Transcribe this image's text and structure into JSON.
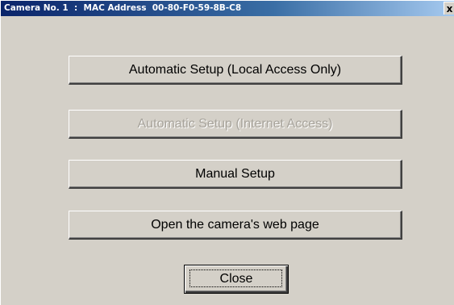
{
  "window": {
    "title": "Camera No. 1  :  MAC Address  00-80-F0-59-8B-C8",
    "close_glyph": "x"
  },
  "buttons": {
    "auto_local": "Automatic Setup (Local Access Only)",
    "auto_internet": "Automatic Setup (Internet Access)",
    "manual": "Manual Setup",
    "open_web": "Open the camera's web page",
    "close": "Close"
  },
  "colors": {
    "face": "#d4d0c8",
    "title_start": "#0a246a",
    "title_end": "#a6caf0",
    "disabled_text": "#a7a39b"
  }
}
